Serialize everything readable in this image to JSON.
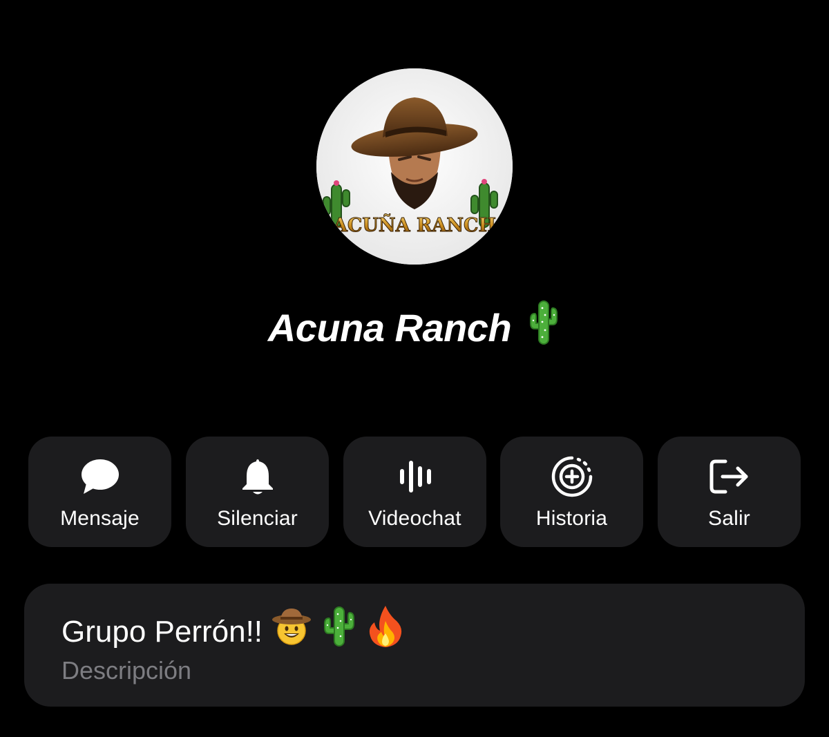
{
  "group": {
    "name": "Acuna Ranch",
    "name_emoji": "cactus-emoji",
    "avatar_logo_text": "ACUÑA RANCH"
  },
  "actions": [
    {
      "label": "Mensaje",
      "icon": "message-bubble-icon"
    },
    {
      "label": "Silenciar",
      "icon": "bell-icon"
    },
    {
      "label": "Videochat",
      "icon": "audio-bars-icon"
    },
    {
      "label": "Historia",
      "icon": "story-add-icon"
    },
    {
      "label": "Salir",
      "icon": "leave-icon"
    }
  ],
  "about": {
    "description": "Grupo Perrón!!",
    "description_emojis": [
      "cowboy-hat-face-emoji",
      "cactus-emoji",
      "fire-emoji"
    ],
    "label": "Descripción"
  },
  "colors": {
    "background": "#000000",
    "card": "#1c1c1e",
    "text": "#ffffff",
    "secondary_text": "#7d7d82"
  }
}
